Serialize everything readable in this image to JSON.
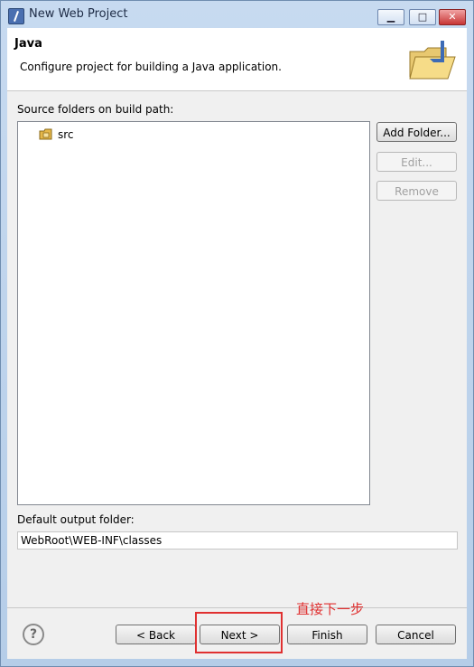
{
  "window": {
    "title": "New Web Project",
    "icon": "eclipse-app-icon"
  },
  "header": {
    "title": "Java",
    "description": "Configure project for building a Java application.",
    "icon": "java-project-wizard-icon"
  },
  "source": {
    "label": "Source folders on build path:",
    "items": [
      {
        "label": "src",
        "icon": "source-folder-icon"
      }
    ],
    "buttons": {
      "add": "Add Folder...",
      "edit": "Edit...",
      "remove": "Remove"
    }
  },
  "output": {
    "label": "Default output folder:",
    "value": "WebRoot\\WEB-INF\\classes"
  },
  "footer": {
    "back": "< Back",
    "next": "Next >",
    "finish": "Finish",
    "cancel": "Cancel"
  },
  "annotation": {
    "text": "直接下一步",
    "color": "#e03030"
  }
}
